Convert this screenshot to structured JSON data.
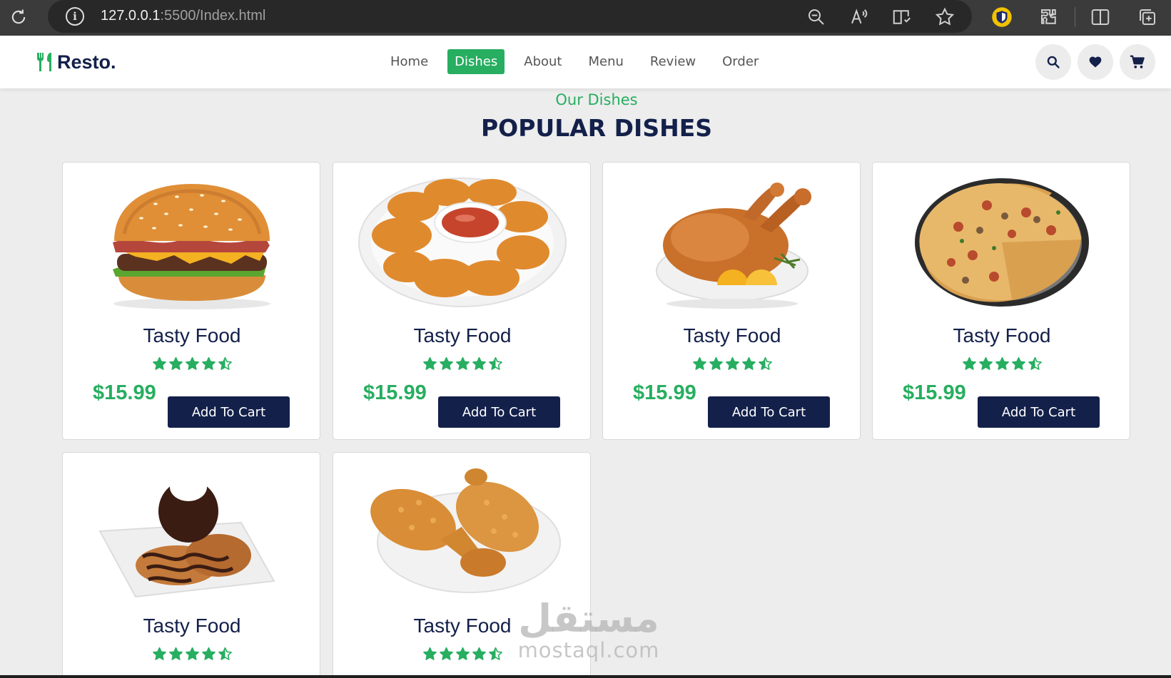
{
  "browser": {
    "url_host": "127.0.0.1",
    "url_path": ":5500/Index.html"
  },
  "navbar": {
    "logo_text": "Resto.",
    "links": [
      "Home",
      "Dishes",
      "About",
      "Menu",
      "Review",
      "Order"
    ],
    "active_link": "Dishes"
  },
  "section": {
    "subheading": "Our Dishes",
    "heading": "POPULAR DISHES"
  },
  "dishes": [
    {
      "image": "burger",
      "title": "Tasty Food",
      "rating": 4.5,
      "price": "$15.99",
      "button": "Add To Cart"
    },
    {
      "image": "chicken-nuggets",
      "title": "Tasty Food",
      "rating": 4.5,
      "price": "$15.99",
      "button": "Add To Cart"
    },
    {
      "image": "roast-chicken",
      "title": "Tasty Food",
      "rating": 4.5,
      "price": "$15.99",
      "button": "Add To Cart"
    },
    {
      "image": "pizza",
      "title": "Tasty Food",
      "rating": 4.5,
      "price": "$15.99",
      "button": "Add To Cart"
    },
    {
      "image": "chocolate-cookie-dessert",
      "title": "Tasty Food",
      "rating": 4.5
    },
    {
      "image": "fried-chicken",
      "title": "Tasty Food",
      "rating": 4.5
    }
  ],
  "watermark": {
    "arabic": "مستقل",
    "latin": "mostaql.com"
  },
  "colors": {
    "green": "#27ae60",
    "navy": "#13204a",
    "background": "#ededed"
  }
}
